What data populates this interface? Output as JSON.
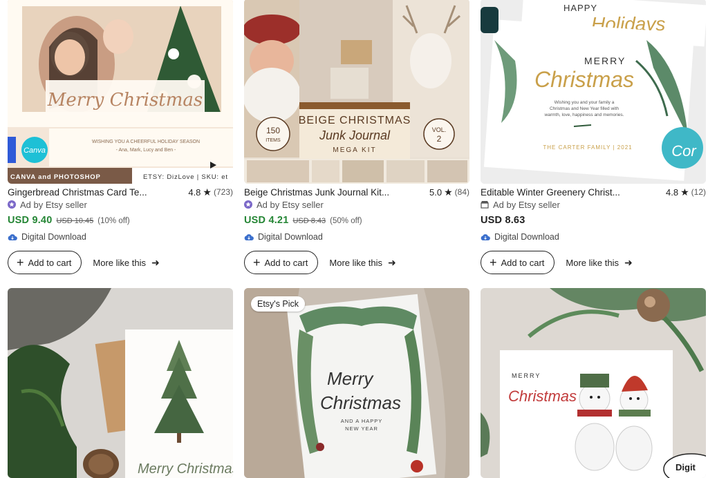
{
  "listings": [
    {
      "title": "Gingerbread Christmas Card Te...",
      "rating": "4.8",
      "reviews": "(723)",
      "ad_label": "Ad by Etsy seller",
      "price": "USD 9.40",
      "original_price": "USD 10.45",
      "discount": "(10% off)",
      "download_label": "Digital Download",
      "cart_label": "Add to cart",
      "more_label": "More like this",
      "image": {
        "caption": "Merry Christmas",
        "logo": "Canva",
        "subtitle": "WISHING YOU A CHEERFUL HOLIDAY SEASON",
        "names": "- Ana, Mark, Lucy and Ben -",
        "footer_left": "CANVA and PHOTOSHOP",
        "footer_right": "ETSY: DizLove | SKU: et"
      }
    },
    {
      "title": "Beige Christmas Junk Journal Kit...",
      "rating": "5.0",
      "reviews": "(84)",
      "ad_label": "Ad by Etsy seller",
      "price": "USD 4.21",
      "original_price": "USD 8.43",
      "discount": "(50% off)",
      "download_label": "Digital Download",
      "cart_label": "Add to cart",
      "more_label": "More like this",
      "image": {
        "title_line1": "BEIGE CHRISTMAS",
        "title_line2": "Junk Journal",
        "title_line3": "MEGA KIT",
        "items_num": "150",
        "items_label": "ITEMS",
        "vol_label": "VOL.",
        "vol_num": "2"
      }
    },
    {
      "title": "Editable Winter Greenery Christ...",
      "rating": "4.8",
      "reviews": "(12)",
      "ad_label": "Ad by Etsy seller",
      "price": "USD 8.63",
      "download_label": "Digital Download",
      "cart_label": "Add to cart",
      "more_label": "More like this",
      "image": {
        "happy": "HAPPY",
        "holidays": "Holidays",
        "merry": "MERRY",
        "christmas": "Christmas",
        "message_1": "Wishing you and your family a",
        "message_2": "Christmas and New Year filled with",
        "message_3": "warmth, love, happiness and memories.",
        "family": "THE CARTER FAMILY | 2021",
        "stamp": "Cor"
      }
    },
    {
      "image": {
        "script_text": "Merry Christmas"
      }
    },
    {
      "badge": "Etsy's Pick",
      "image": {
        "merry": "Merry",
        "christmas": "Christmas",
        "line1": "AND A HAPPY",
        "line2": "NEW YEAR"
      }
    },
    {
      "image": {
        "merry": "MERRY",
        "christmas": "Christmas",
        "corner_badge": "Digit"
      }
    }
  ],
  "colors": {
    "sale_price": "#258635",
    "ad_star": "#7b68c8",
    "cloud": "#3b6fcc"
  }
}
